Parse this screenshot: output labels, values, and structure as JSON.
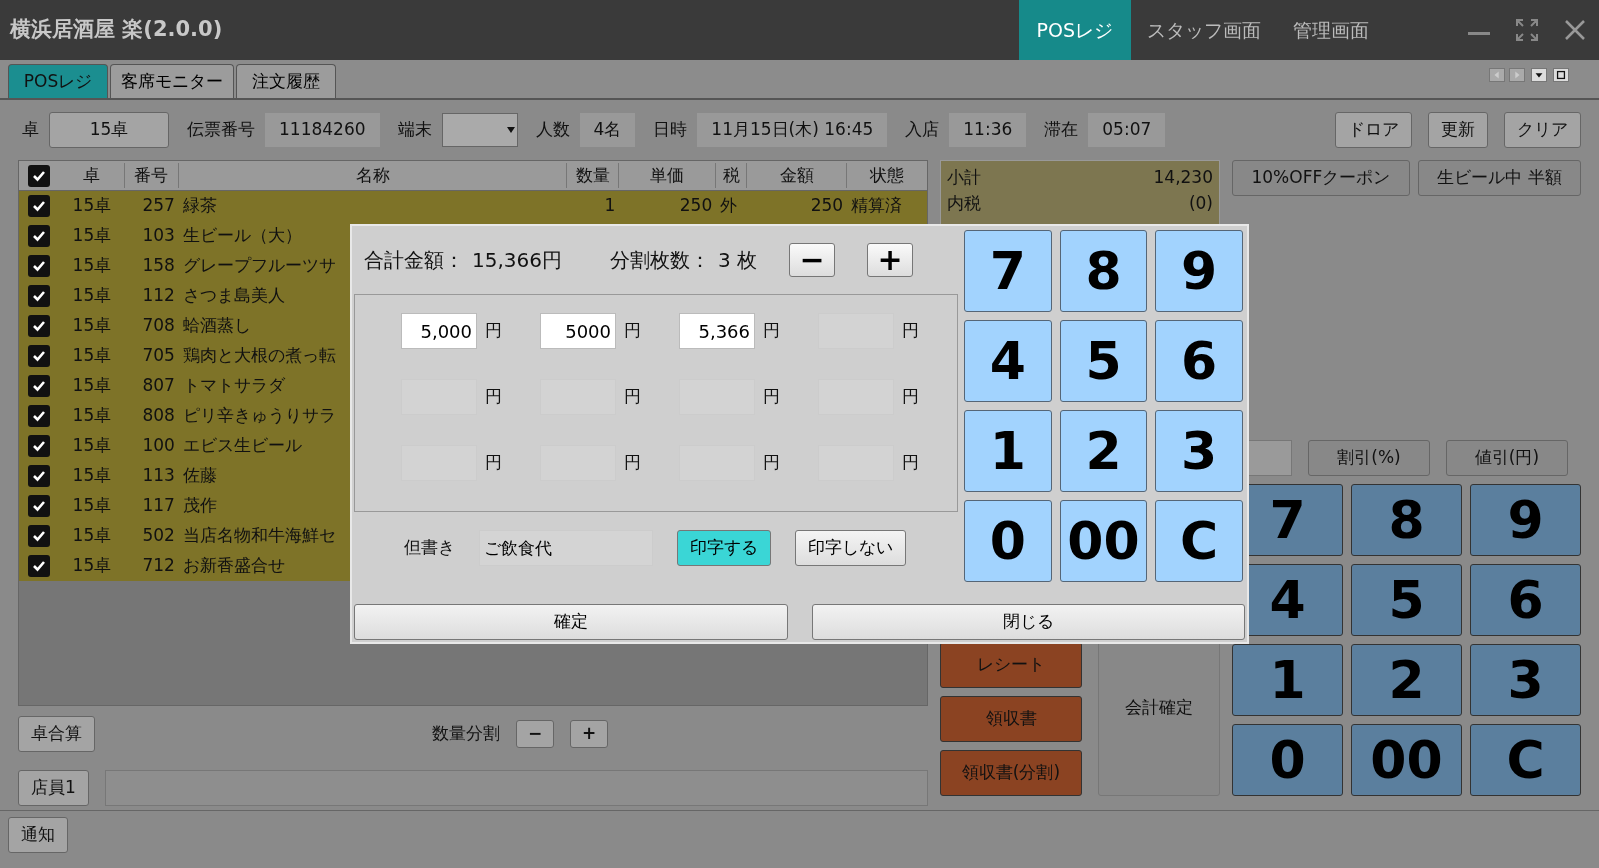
{
  "window": {
    "title": "横浜居酒屋 楽(2.0.0)",
    "modes": [
      {
        "label": "POSレジ",
        "selected": true
      },
      {
        "label": "スタッフ画面",
        "selected": false
      },
      {
        "label": "管理画面",
        "selected": false
      }
    ]
  },
  "tabs": [
    {
      "label": "POSレジ",
      "selected": true
    },
    {
      "label": "客席モニター",
      "selected": false
    },
    {
      "label": "注文履歴",
      "selected": false
    }
  ],
  "header": {
    "fields": [
      {
        "label": "卓",
        "value": "15卓",
        "kind": "button"
      },
      {
        "label": "伝票番号",
        "value": "11184260",
        "kind": "text"
      },
      {
        "label": "端末",
        "kind": "select"
      },
      {
        "label": "人数",
        "value": "4名",
        "kind": "text"
      },
      {
        "label": "日時",
        "value": "11月15日(木) 16:45",
        "kind": "text"
      },
      {
        "label": "入店",
        "value": "11:36",
        "kind": "text"
      },
      {
        "label": "滞在",
        "value": "05:07",
        "kind": "text"
      }
    ],
    "buttons": [
      "ドロア",
      "更新",
      "クリア"
    ]
  },
  "table": {
    "all_checked": true,
    "columns": [
      "卓",
      "番号",
      "名称",
      "数量",
      "単価",
      "税",
      "金額",
      "状態"
    ],
    "rows": [
      {
        "checked": true,
        "cells": [
          "15卓",
          "257",
          "緑茶",
          "1",
          "250",
          "外",
          "250",
          "精算済"
        ]
      },
      {
        "checked": true,
        "cells": [
          "15卓",
          "103",
          "生ビール（大）"
        ]
      },
      {
        "checked": true,
        "cells": [
          "15卓",
          "158",
          "グレープフルーツサ"
        ]
      },
      {
        "checked": true,
        "cells": [
          "15卓",
          "112",
          "さつま島美人"
        ]
      },
      {
        "checked": true,
        "cells": [
          "15卓",
          "708",
          "蛤酒蒸し"
        ]
      },
      {
        "checked": true,
        "cells": [
          "15卓",
          "705",
          "鶏肉と大根の煮っ転"
        ]
      },
      {
        "checked": true,
        "cells": [
          "15卓",
          "807",
          "トマトサラダ"
        ]
      },
      {
        "checked": true,
        "cells": [
          "15卓",
          "808",
          "ピリ辛きゅうりサラ"
        ]
      },
      {
        "checked": true,
        "cells": [
          "15卓",
          "100",
          "エビス生ビール"
        ]
      },
      {
        "checked": true,
        "cells": [
          "15卓",
          "113",
          "佐藤"
        ]
      },
      {
        "checked": true,
        "cells": [
          "15卓",
          "117",
          "茂作"
        ]
      },
      {
        "checked": true,
        "cells": [
          "15卓",
          "502",
          "当店名物和牛海鮮セ"
        ]
      },
      {
        "checked": true,
        "cells": [
          "15卓",
          "712",
          "お新香盛合せ"
        ]
      }
    ]
  },
  "table_merge_button": "卓合算",
  "qty_split": {
    "label": "数量分割",
    "minus": "−",
    "plus": "+"
  },
  "staff_button": "店員1",
  "notify_button": "通知",
  "summary": [
    {
      "label": "小計",
      "value": "14,230"
    },
    {
      "label": "内税",
      "value": "(0)"
    }
  ],
  "coupons": [
    "10%OFFクーポン",
    "生ビール中 半額"
  ],
  "discount_buttons": [
    "割引(%)",
    "値引(円)"
  ],
  "keypad": [
    "7",
    "8",
    "9",
    "4",
    "5",
    "6",
    "1",
    "2",
    "3",
    "0",
    "00",
    "C"
  ],
  "receipt_buttons": [
    "レシート",
    "領収書",
    "領収書(分割)"
  ],
  "checkout_button": "会計確定",
  "dialog": {
    "total_label": "合計金額：",
    "total": "15,366円",
    "split_label": "分割枚数：",
    "split": "3 枚",
    "minus": "−",
    "plus": "+",
    "amounts": [
      {
        "value": "5,000",
        "disabled": false,
        "unit": "円"
      },
      {
        "value": "5000",
        "disabled": false,
        "unit": "円"
      },
      {
        "value": "5,366",
        "disabled": false,
        "unit": "円"
      },
      {
        "disabled": true,
        "unit": "円"
      },
      {
        "disabled": true,
        "unit": "円"
      },
      {
        "disabled": true,
        "unit": "円"
      },
      {
        "disabled": true,
        "unit": "円"
      },
      {
        "disabled": true,
        "unit": "円"
      },
      {
        "disabled": true,
        "unit": "円"
      },
      {
        "disabled": true,
        "unit": "円"
      },
      {
        "disabled": true,
        "unit": "円"
      },
      {
        "disabled": true,
        "unit": "円"
      }
    ],
    "note_label": "但書き",
    "note": "ご飲食代",
    "print_options": [
      {
        "label": "印字する",
        "selected": true
      },
      {
        "label": "印字しない",
        "selected": false
      }
    ],
    "keypad": [
      "7",
      "8",
      "9",
      "4",
      "5",
      "6",
      "1",
      "2",
      "3",
      "0",
      "00",
      "C"
    ],
    "buttons": [
      "確定",
      "閉じる"
    ]
  }
}
